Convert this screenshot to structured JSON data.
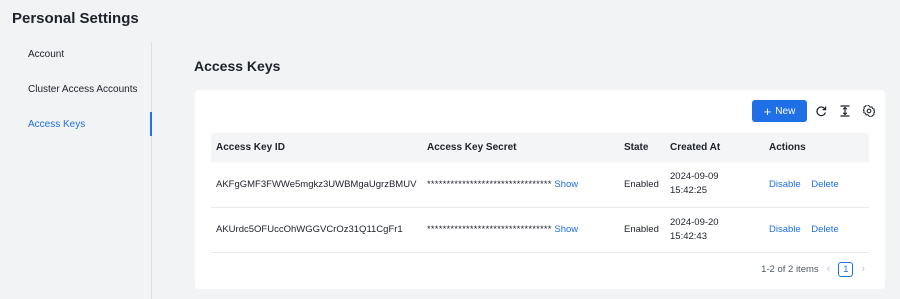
{
  "page_title": "Personal Settings",
  "sidebar": {
    "items": [
      {
        "label": "Account"
      },
      {
        "label": "Cluster Access Accounts"
      },
      {
        "label": "Access Keys"
      }
    ]
  },
  "section_title": "Access Keys",
  "toolbar": {
    "new_label": "New",
    "icons": [
      "refresh-icon",
      "column-height-icon",
      "settings-icon"
    ]
  },
  "table": {
    "headers": [
      "Access Key ID",
      "Access Key Secret",
      "State",
      "Created At",
      "Actions"
    ],
    "rows": [
      {
        "id": "AKFgGMF3FWWe5mgkz3UWBMgaUgrzBMUV",
        "secret": "********************************",
        "show": "Show",
        "state": "Enabled",
        "date": "2024-09-09",
        "time": "15:42:25",
        "disable": "Disable",
        "delete": "Delete"
      },
      {
        "id": "AKUrdc5OFUccOhWGGVCrOz31Q11CgFr1",
        "secret": "********************************",
        "show": "Show",
        "state": "Enabled",
        "date": "2024-09-20",
        "time": "15:42:43",
        "disable": "Disable",
        "delete": "Delete"
      }
    ]
  },
  "pagination": {
    "summary": "1-2 of 2 items",
    "current_page": "1"
  },
  "colors": {
    "accent": "#1f6fe6",
    "background": "#f2f3f5"
  }
}
